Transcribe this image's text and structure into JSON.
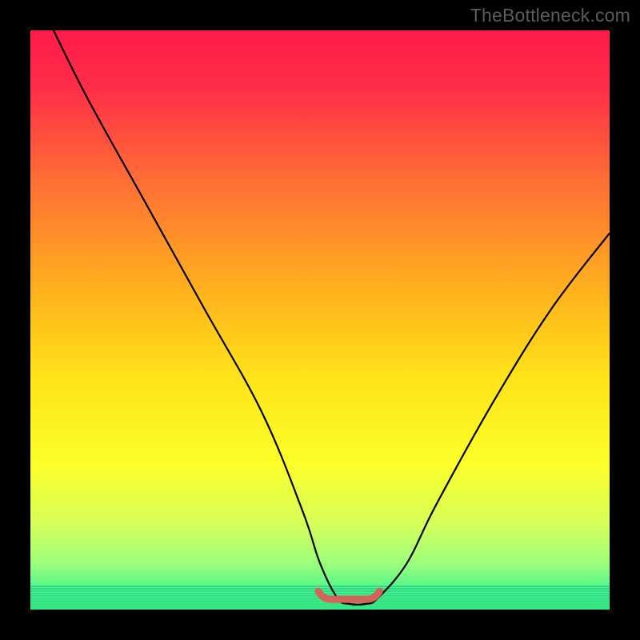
{
  "watermark": "TheBottleneck.com",
  "chart_data": {
    "type": "line",
    "title": "",
    "xlabel": "",
    "ylabel": "",
    "xlim": [
      0,
      100
    ],
    "ylim": [
      0,
      100
    ],
    "series": [
      {
        "name": "bottleneck-curve",
        "x": [
          4,
          10,
          20,
          30,
          40,
          47,
          50,
          53,
          55,
          58,
          60,
          65,
          70,
          80,
          90,
          100
        ],
        "values": [
          100,
          88,
          70,
          52,
          34,
          17,
          8,
          2,
          1,
          1,
          2,
          8,
          18,
          36,
          52,
          65
        ]
      }
    ],
    "annotations": [
      {
        "name": "optimal-band",
        "x_start": 50,
        "x_end": 60,
        "y": 1.5
      }
    ],
    "gradient_stops": [
      {
        "offset": 0.0,
        "color": "#ff1a4b"
      },
      {
        "offset": 0.1,
        "color": "#ff2e47"
      },
      {
        "offset": 0.25,
        "color": "#ff6a36"
      },
      {
        "offset": 0.45,
        "color": "#ffb21e"
      },
      {
        "offset": 0.6,
        "color": "#ffe319"
      },
      {
        "offset": 0.75,
        "color": "#fbff2a"
      },
      {
        "offset": 0.85,
        "color": "#d8ff58"
      },
      {
        "offset": 0.92,
        "color": "#9bff7a"
      },
      {
        "offset": 0.965,
        "color": "#52f58d"
      },
      {
        "offset": 1.0,
        "color": "#16e57a"
      }
    ],
    "bottom_band_lines": [
      "#6de38a",
      "#5fe08b",
      "#52dc8b",
      "#46d98b",
      "#3ad58a",
      "#2fd189",
      "#25cd87",
      "#1cc984",
      "#14c481",
      "#0ebf7d"
    ],
    "colors": {
      "curve": "#000000",
      "marker": "#d4645a"
    }
  }
}
